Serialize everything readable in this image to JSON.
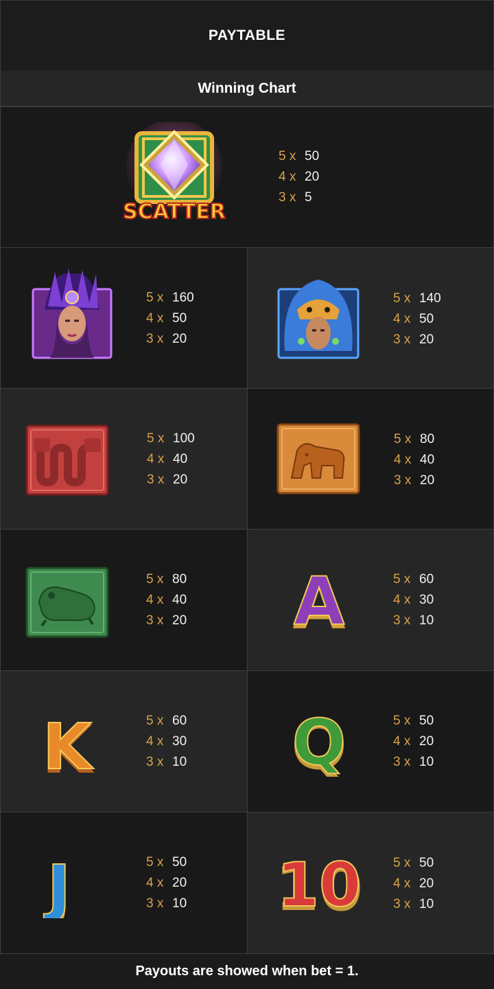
{
  "header": {
    "title": "PAYTABLE"
  },
  "subheader": {
    "title": "Winning Chart"
  },
  "scatter": {
    "label": "SCATTER",
    "pays": [
      {
        "m": "5 x",
        "v": "50"
      },
      {
        "m": "4 x",
        "v": "20"
      },
      {
        "m": "3 x",
        "v": "5"
      }
    ]
  },
  "symbols": [
    {
      "name": "warrior-woman",
      "icon": "warrior-woman-icon",
      "pays": [
        {
          "m": "5 x",
          "v": "160"
        },
        {
          "m": "4 x",
          "v": "50"
        },
        {
          "m": "3 x",
          "v": "20"
        }
      ]
    },
    {
      "name": "jaguar-warrior",
      "icon": "jaguar-warrior-icon",
      "pays": [
        {
          "m": "5 x",
          "v": "140"
        },
        {
          "m": "4 x",
          "v": "50"
        },
        {
          "m": "3 x",
          "v": "20"
        }
      ]
    },
    {
      "name": "red-serpent-tablet",
      "icon": "serpent-tablet-icon",
      "pays": [
        {
          "m": "5 x",
          "v": "100"
        },
        {
          "m": "4 x",
          "v": "40"
        },
        {
          "m": "3 x",
          "v": "20"
        }
      ]
    },
    {
      "name": "orange-jaguar-tablet",
      "icon": "jaguar-tablet-icon",
      "pays": [
        {
          "m": "5 x",
          "v": "80"
        },
        {
          "m": "4 x",
          "v": "40"
        },
        {
          "m": "3 x",
          "v": "20"
        }
      ]
    },
    {
      "name": "green-frog-tablet",
      "icon": "frog-tablet-icon",
      "pays": [
        {
          "m": "5 x",
          "v": "80"
        },
        {
          "m": "4 x",
          "v": "40"
        },
        {
          "m": "3 x",
          "v": "20"
        }
      ]
    },
    {
      "name": "letter-a",
      "icon": "letter-a-icon",
      "glyph": "A",
      "pays": [
        {
          "m": "5 x",
          "v": "60"
        },
        {
          "m": "4 x",
          "v": "30"
        },
        {
          "m": "3 x",
          "v": "10"
        }
      ]
    },
    {
      "name": "letter-k",
      "icon": "letter-k-icon",
      "glyph": "K",
      "pays": [
        {
          "m": "5 x",
          "v": "60"
        },
        {
          "m": "4 x",
          "v": "30"
        },
        {
          "m": "3 x",
          "v": "10"
        }
      ]
    },
    {
      "name": "letter-q",
      "icon": "letter-q-icon",
      "glyph": "Q",
      "pays": [
        {
          "m": "5 x",
          "v": "50"
        },
        {
          "m": "4 x",
          "v": "20"
        },
        {
          "m": "3 x",
          "v": "10"
        }
      ]
    },
    {
      "name": "letter-j",
      "icon": "letter-j-icon",
      "glyph": "J",
      "pays": [
        {
          "m": "5 x",
          "v": "50"
        },
        {
          "m": "4 x",
          "v": "20"
        },
        {
          "m": "3 x",
          "v": "10"
        }
      ]
    },
    {
      "name": "number-10",
      "icon": "number-ten-icon",
      "glyph": "10",
      "pays": [
        {
          "m": "5 x",
          "v": "50"
        },
        {
          "m": "4 x",
          "v": "20"
        },
        {
          "m": "3 x",
          "v": "10"
        }
      ]
    }
  ],
  "footer": {
    "note": "Payouts are showed when bet = 1."
  }
}
